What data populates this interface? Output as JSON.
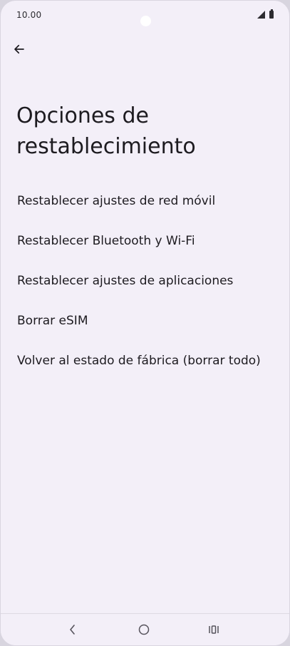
{
  "status_bar": {
    "time": "10.00",
    "icons": [
      "signal-icon",
      "battery-icon"
    ]
  },
  "header": {
    "back_icon": "arrow-left-icon",
    "title": "Opciones de restablecimiento"
  },
  "options": [
    {
      "label": "Restablecer ajustes de red móvil"
    },
    {
      "label": "Restablecer Bluetooth y Wi-Fi"
    },
    {
      "label": "Restablecer ajustes de aplicaciones"
    },
    {
      "label": "Borrar eSIM"
    },
    {
      "label": "Volver al estado de fábrica (borrar todo)"
    }
  ],
  "nav_bar": {
    "icons": [
      "chevron-left-icon",
      "home-circle-icon",
      "recents-icon"
    ]
  },
  "colors": {
    "background": "#f3eff8",
    "text": "#1d1b20"
  }
}
